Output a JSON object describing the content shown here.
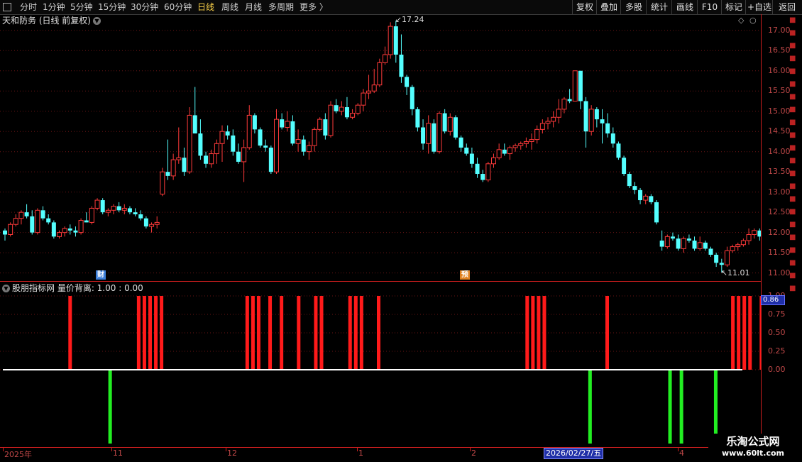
{
  "toolbar": {
    "periods": [
      "分时",
      "1分钟",
      "5分钟",
      "15分钟",
      "30分钟",
      "60分钟",
      "日线",
      "周线",
      "月线",
      "多周期",
      "更多 〉"
    ],
    "active_period": "日线",
    "buttons": [
      "复权",
      "叠加",
      "多股",
      "统计",
      "画线",
      "F10",
      "标记",
      "+自选",
      "返回"
    ]
  },
  "main_chart": {
    "title": "天和防务 (日线 前复权)",
    "high_label": "17.24",
    "low_label": "11.01",
    "flags": {
      "cai": "财",
      "yu": "预"
    }
  },
  "indicator": {
    "title": "股朋指标网  量价背离: 1.00 : 0.00",
    "current_value": "0.86"
  },
  "x_axis": {
    "labels": [
      "2025年",
      "11",
      "12",
      "1",
      "2",
      "4"
    ],
    "cursor_date": "2026/02/27/五"
  },
  "watermark": {
    "name": "乐淘公式网",
    "url": "www.60lt.com"
  },
  "colors": {
    "up": "#ff3a3a",
    "down": "#54ffff",
    "background": "#000000",
    "red_bar": "#ff1a1a",
    "green_bar": "#22ee22"
  },
  "chart_data": [
    {
      "type": "candlestick",
      "title": "天和防务 (日线 前复权)",
      "ylim": [
        10.8,
        17.4
      ],
      "y_ticks": [
        "11.00",
        "11.50",
        "12.00",
        "12.50",
        "13.00",
        "13.50",
        "14.00",
        "14.50",
        "15.00",
        "15.50",
        "16.00",
        "16.50",
        "17.00"
      ],
      "annotations": {
        "high": 17.24,
        "low": 11.01
      },
      "ohlc": [
        [
          12.05,
          12.1,
          11.8,
          11.95
        ],
        [
          11.95,
          12.25,
          11.9,
          12.2
        ],
        [
          12.2,
          12.45,
          12.15,
          12.35
        ],
        [
          12.35,
          12.55,
          12.2,
          12.5
        ],
        [
          12.5,
          12.7,
          12.35,
          12.4
        ],
        [
          12.4,
          12.55,
          11.95,
          12.0
        ],
        [
          12.0,
          12.6,
          11.95,
          12.55
        ],
        [
          12.55,
          12.65,
          12.3,
          12.35
        ],
        [
          12.35,
          12.45,
          12.2,
          12.25
        ],
        [
          12.25,
          12.3,
          11.85,
          11.9
        ],
        [
          11.9,
          12.05,
          11.85,
          12.0
        ],
        [
          12.0,
          12.15,
          11.9,
          12.1
        ],
        [
          12.1,
          12.2,
          11.95,
          12.05
        ],
        [
          12.05,
          12.15,
          11.9,
          12.0
        ],
        [
          12.0,
          12.35,
          11.95,
          12.3
        ],
        [
          12.3,
          12.5,
          12.25,
          12.25
        ],
        [
          12.25,
          12.65,
          12.2,
          12.6
        ],
        [
          12.6,
          12.85,
          12.55,
          12.8
        ],
        [
          12.8,
          12.85,
          12.45,
          12.5
        ],
        [
          12.5,
          12.6,
          12.4,
          12.55
        ],
        [
          12.55,
          12.7,
          12.45,
          12.65
        ],
        [
          12.65,
          12.75,
          12.5,
          12.55
        ],
        [
          12.55,
          12.7,
          12.45,
          12.6
        ],
        [
          12.6,
          12.65,
          12.45,
          12.5
        ],
        [
          12.5,
          12.6,
          12.4,
          12.45
        ],
        [
          12.45,
          12.55,
          12.3,
          12.35
        ],
        [
          12.35,
          12.4,
          12.1,
          12.15
        ],
        [
          12.15,
          12.25,
          12.0,
          12.2
        ],
        [
          12.2,
          12.4,
          12.1,
          12.25
        ],
        [
          12.95,
          13.6,
          12.9,
          13.5
        ],
        [
          13.5,
          14.3,
          13.3,
          13.4
        ],
        [
          13.4,
          13.95,
          13.3,
          13.8
        ],
        [
          13.8,
          14.6,
          13.7,
          13.85
        ],
        [
          13.85,
          14.1,
          13.4,
          13.5
        ],
        [
          13.5,
          15.1,
          13.45,
          14.9
        ],
        [
          14.9,
          15.6,
          14.8,
          14.45
        ],
        [
          14.45,
          14.8,
          13.8,
          13.9
        ],
        [
          13.9,
          14.0,
          13.6,
          13.7
        ],
        [
          13.7,
          14.05,
          13.6,
          13.95
        ],
        [
          13.95,
          14.3,
          13.7,
          14.2
        ],
        [
          14.2,
          14.65,
          13.75,
          14.5
        ],
        [
          14.5,
          14.65,
          14.3,
          14.4
        ],
        [
          14.4,
          14.55,
          13.9,
          14.0
        ],
        [
          14.0,
          14.2,
          13.7,
          13.75
        ],
        [
          13.75,
          14.3,
          13.25,
          14.1
        ],
        [
          14.1,
          15.15,
          14.05,
          14.9
        ],
        [
          14.9,
          14.95,
          14.45,
          14.55
        ],
        [
          14.55,
          14.6,
          14.1,
          14.15
        ],
        [
          14.15,
          14.3,
          14.0,
          14.1
        ],
        [
          14.1,
          14.15,
          13.45,
          13.5
        ],
        [
          13.5,
          15.05,
          13.45,
          14.8
        ],
        [
          14.8,
          14.95,
          14.55,
          14.6
        ],
        [
          14.6,
          15.0,
          14.5,
          14.75
        ],
        [
          14.75,
          14.9,
          14.15,
          14.2
        ],
        [
          14.2,
          14.55,
          14.0,
          14.3
        ],
        [
          14.3,
          14.4,
          13.9,
          14.0
        ],
        [
          14.0,
          14.25,
          13.8,
          14.15
        ],
        [
          14.15,
          14.6,
          14.0,
          14.55
        ],
        [
          14.55,
          14.85,
          14.5,
          14.8
        ],
        [
          14.8,
          14.95,
          14.3,
          14.4
        ],
        [
          14.4,
          15.25,
          14.35,
          15.15
        ],
        [
          15.15,
          15.3,
          14.95,
          15.0
        ],
        [
          15.0,
          15.25,
          14.9,
          15.1
        ],
        [
          15.1,
          15.35,
          14.8,
          14.85
        ],
        [
          14.85,
          15.05,
          14.8,
          14.95
        ],
        [
          14.95,
          15.2,
          14.9,
          15.15
        ],
        [
          15.15,
          15.55,
          15.0,
          15.45
        ],
        [
          15.45,
          15.9,
          15.3,
          15.5
        ],
        [
          15.5,
          16.05,
          15.45,
          15.65
        ],
        [
          15.65,
          16.3,
          15.6,
          16.2
        ],
        [
          16.2,
          16.6,
          16.15,
          16.4
        ],
        [
          16.4,
          17.2,
          16.3,
          17.1
        ],
        [
          17.1,
          17.24,
          16.2,
          16.4
        ],
        [
          16.4,
          16.9,
          15.7,
          15.85
        ],
        [
          15.85,
          15.9,
          15.4,
          15.6
        ],
        [
          15.6,
          15.65,
          14.9,
          15.05
        ],
        [
          15.05,
          15.1,
          14.5,
          14.6
        ],
        [
          14.6,
          14.8,
          14.05,
          14.2
        ],
        [
          14.2,
          14.9,
          13.95,
          14.7
        ],
        [
          14.7,
          14.8,
          13.95,
          14.0
        ],
        [
          14.0,
          15.0,
          13.95,
          14.95
        ],
        [
          14.95,
          15.05,
          14.45,
          14.5
        ],
        [
          14.5,
          14.95,
          14.4,
          14.85
        ],
        [
          14.85,
          14.9,
          14.3,
          14.35
        ],
        [
          14.35,
          14.4,
          14.0,
          14.1
        ],
        [
          14.1,
          14.2,
          13.9,
          13.95
        ],
        [
          13.95,
          14.1,
          13.6,
          13.7
        ],
        [
          13.7,
          13.85,
          13.35,
          13.45
        ],
        [
          13.45,
          13.55,
          13.25,
          13.3
        ],
        [
          13.3,
          13.75,
          13.25,
          13.7
        ],
        [
          13.7,
          13.95,
          13.6,
          13.85
        ],
        [
          13.85,
          14.2,
          13.8,
          14.05
        ],
        [
          14.05,
          14.2,
          13.9,
          13.95
        ],
        [
          13.95,
          14.15,
          13.8,
          14.1
        ],
        [
          14.1,
          14.2,
          14.0,
          14.15
        ],
        [
          14.15,
          14.25,
          14.05,
          14.2
        ],
        [
          14.2,
          14.35,
          14.1,
          14.25
        ],
        [
          14.25,
          14.45,
          14.05,
          14.3
        ],
        [
          14.3,
          14.65,
          14.2,
          14.55
        ],
        [
          14.55,
          14.8,
          14.45,
          14.7
        ],
        [
          14.7,
          14.85,
          14.55,
          14.75
        ],
        [
          14.75,
          15.0,
          14.6,
          14.85
        ],
        [
          14.85,
          15.3,
          14.7,
          15.05
        ],
        [
          15.05,
          15.35,
          14.95,
          15.3
        ],
        [
          15.3,
          15.55,
          15.2,
          15.25
        ],
        [
          15.25,
          15.5,
          16.0,
          16.0
        ],
        [
          16.0,
          16.0,
          15.05,
          15.25
        ],
        [
          15.25,
          15.35,
          14.1,
          14.5
        ],
        [
          14.5,
          15.15,
          14.4,
          15.05
        ],
        [
          15.05,
          15.1,
          14.6,
          14.8
        ],
        [
          14.8,
          15.05,
          14.2,
          14.7
        ],
        [
          14.7,
          14.95,
          14.35,
          14.45
        ],
        [
          14.45,
          14.6,
          14.1,
          14.2
        ],
        [
          14.2,
          14.25,
          13.8,
          13.85
        ],
        [
          13.85,
          13.9,
          13.4,
          13.45
        ],
        [
          13.45,
          13.5,
          13.1,
          13.15
        ],
        [
          13.15,
          13.25,
          12.95,
          13.05
        ],
        [
          13.05,
          13.1,
          12.7,
          12.8
        ],
        [
          12.8,
          12.95,
          12.7,
          12.9
        ],
        [
          12.9,
          12.95,
          12.7,
          12.75
        ],
        [
          12.75,
          12.8,
          12.2,
          12.25
        ],
        [
          11.8,
          12.05,
          11.55,
          11.65
        ],
        [
          11.65,
          11.95,
          11.6,
          11.9
        ],
        [
          11.9,
          12.0,
          11.8,
          11.85
        ],
        [
          11.85,
          11.95,
          11.55,
          11.6
        ],
        [
          11.6,
          11.9,
          11.5,
          11.85
        ],
        [
          11.85,
          11.95,
          11.75,
          11.8
        ],
        [
          11.8,
          11.9,
          11.55,
          11.6
        ],
        [
          11.6,
          11.9,
          11.55,
          11.75
        ],
        [
          11.75,
          11.8,
          11.55,
          11.6
        ],
        [
          11.6,
          11.65,
          11.4,
          11.45
        ],
        [
          11.45,
          11.5,
          11.15,
          11.25
        ],
        [
          11.25,
          11.35,
          11.01,
          11.2
        ],
        [
          11.2,
          11.65,
          11.15,
          11.55
        ],
        [
          11.55,
          11.7,
          11.5,
          11.65
        ],
        [
          11.65,
          11.75,
          11.55,
          11.7
        ],
        [
          11.7,
          11.85,
          11.65,
          11.8
        ],
        [
          11.8,
          12.1,
          11.7,
          11.95
        ],
        [
          11.95,
          12.1,
          11.85,
          12.05
        ],
        [
          12.05,
          12.1,
          11.8,
          11.9
        ],
        [
          11.9,
          12.1,
          11.85,
          12.0
        ]
      ]
    },
    {
      "type": "bar",
      "title": "量价背离",
      "ylim": [
        -1.0,
        1.0
      ],
      "y_ticks": [
        "0.00",
        "0.25",
        "0.50",
        "0.75",
        "1.00"
      ],
      "red_bar_indices": [
        6,
        18,
        19,
        20,
        21,
        22,
        37,
        38,
        39,
        41,
        43,
        46,
        49,
        50,
        55,
        56,
        57,
        60,
        86,
        87,
        88,
        89,
        100,
        122,
        123,
        124,
        125,
        127,
        128
      ],
      "green_bar_indices": [
        13,
        97,
        111,
        113,
        119
      ],
      "red_value": 1.0,
      "green_value": -1.0
    }
  ]
}
